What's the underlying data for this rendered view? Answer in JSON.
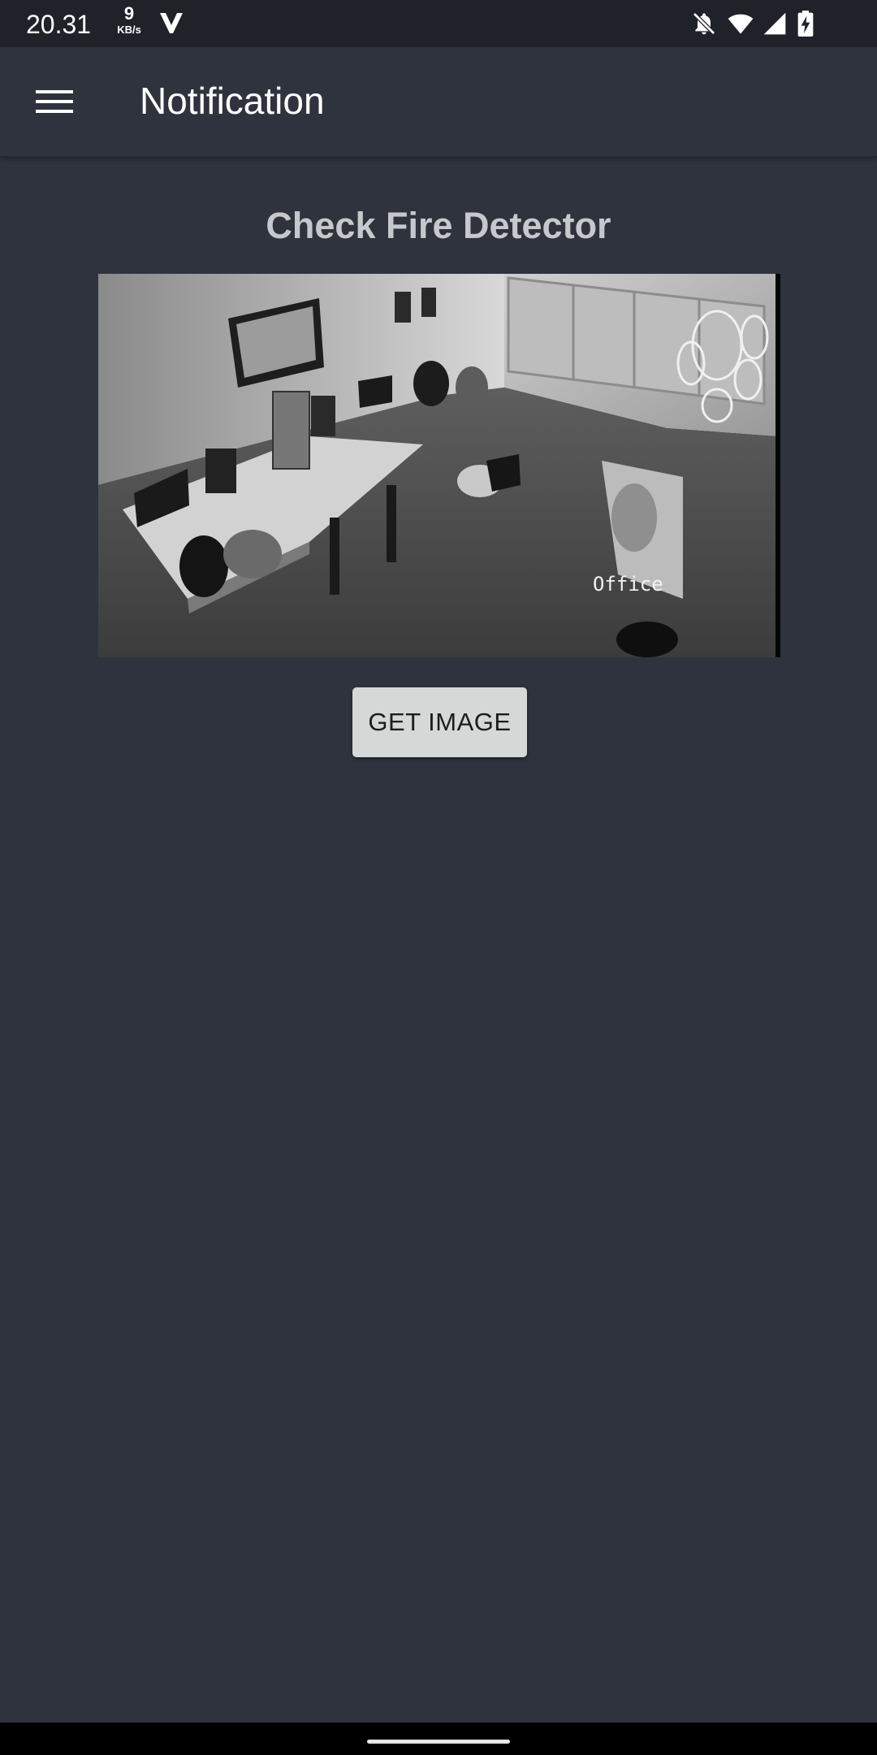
{
  "status_bar": {
    "time": "20.31",
    "net_speed_value": "9",
    "net_speed_unit": "KB/s",
    "icons": [
      "vpn-v-icon",
      "notifications-off-icon",
      "wifi-icon",
      "cell-signal-icon",
      "battery-charging-icon"
    ]
  },
  "app_bar": {
    "menu_icon": "hamburger-menu-icon",
    "title": "Notification"
  },
  "main": {
    "heading": "Check Fire Detector",
    "camera_overlay_label": "Office",
    "get_image_label": "GET IMAGE"
  },
  "colors": {
    "background": "#2e333d",
    "status_bar": "#1f2228",
    "heading_text": "#c6c8cc",
    "button_bg": "#d6d7d7",
    "button_text": "#1d1d1d"
  }
}
